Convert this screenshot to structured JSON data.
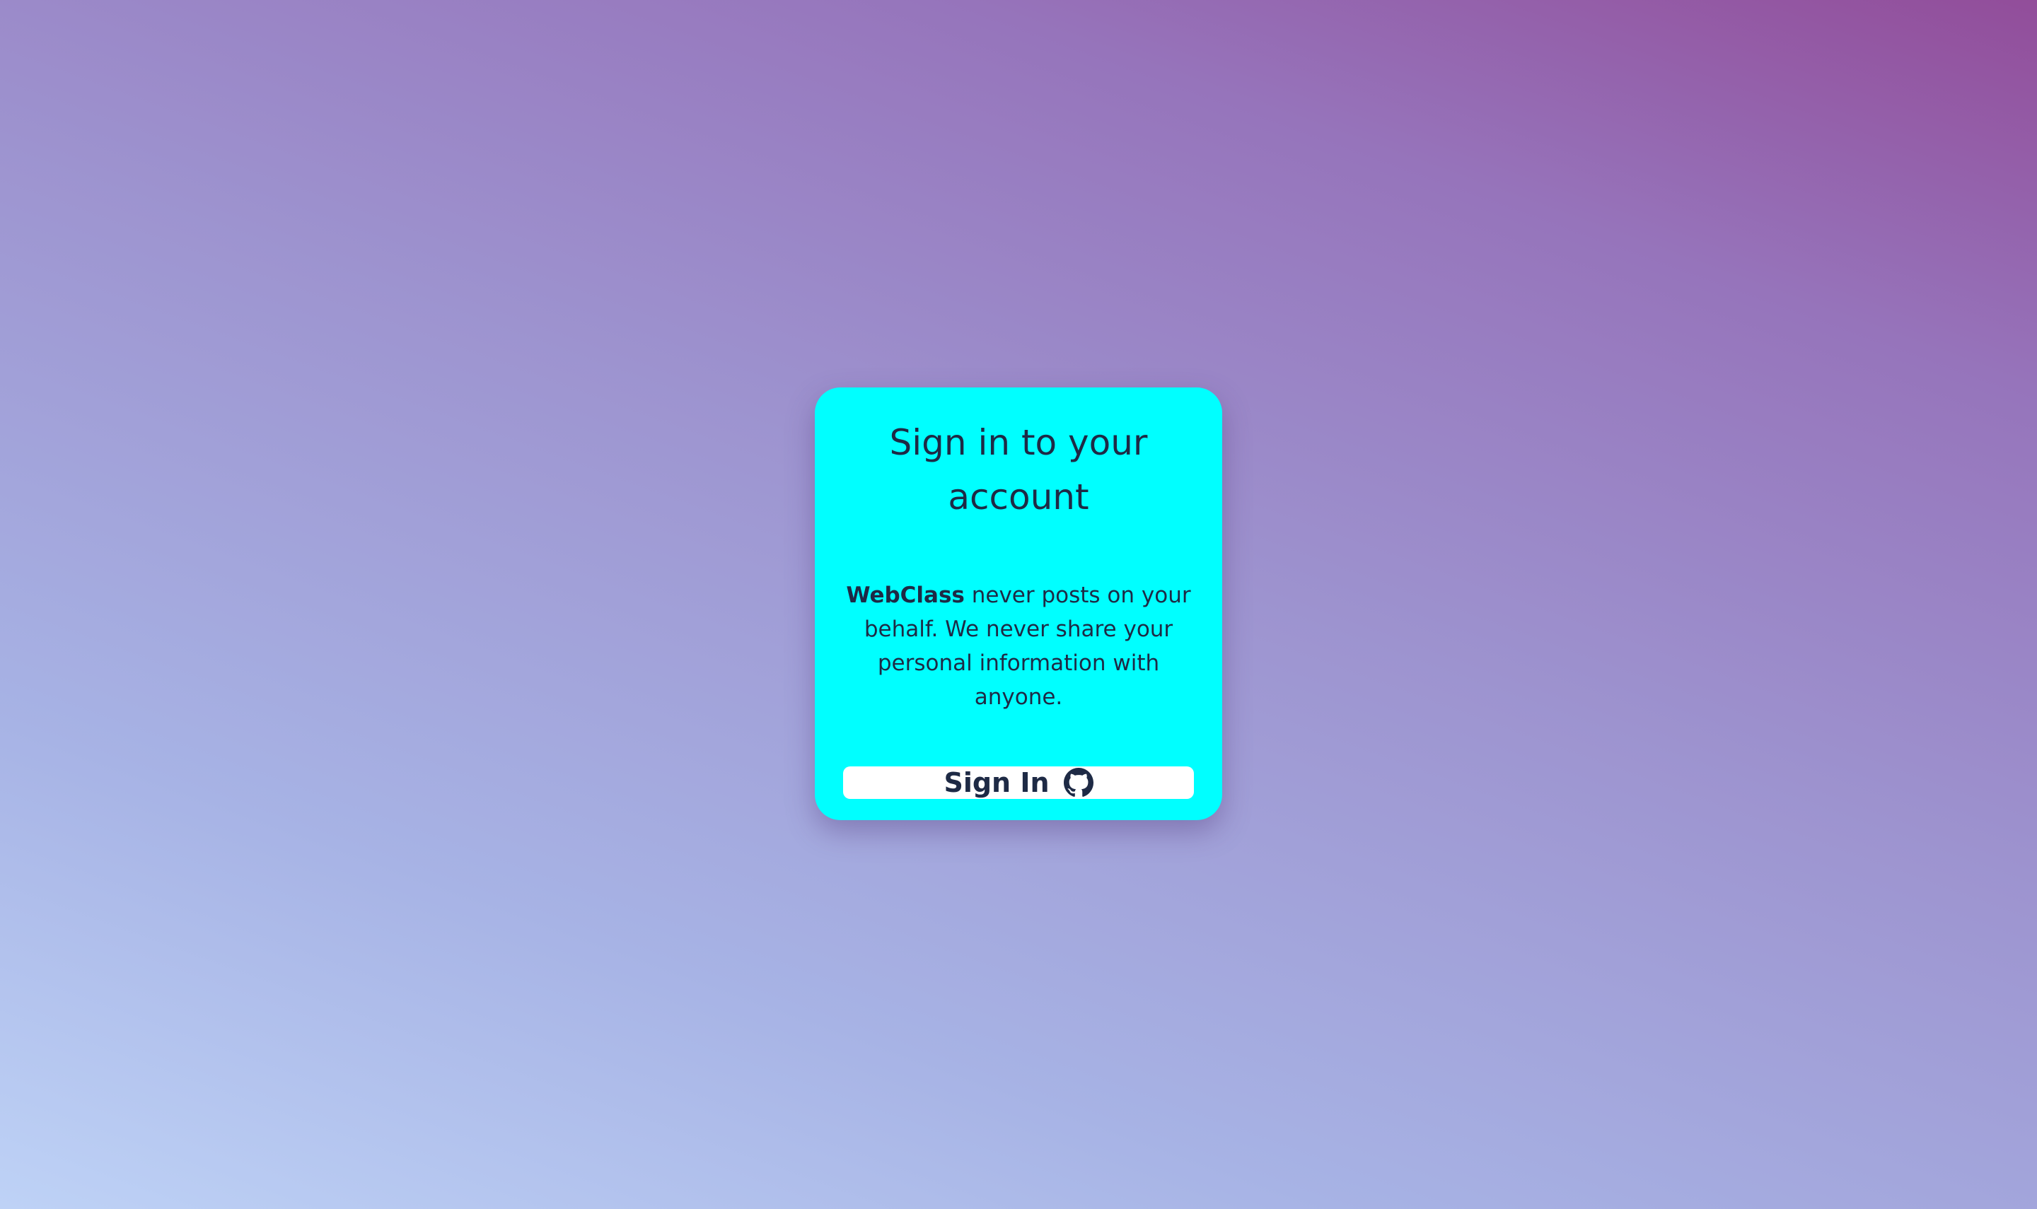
{
  "card": {
    "title": "Sign in to your account",
    "description_brand": "WebClass",
    "description_rest": " never posts on your behalf. We never share your personal information with anyone.",
    "signin_label": "Sign In",
    "signin_icon": "github-icon"
  },
  "colors": {
    "card_background": "#00ffff",
    "button_background": "#ffffff",
    "text": "#1e2a45"
  }
}
